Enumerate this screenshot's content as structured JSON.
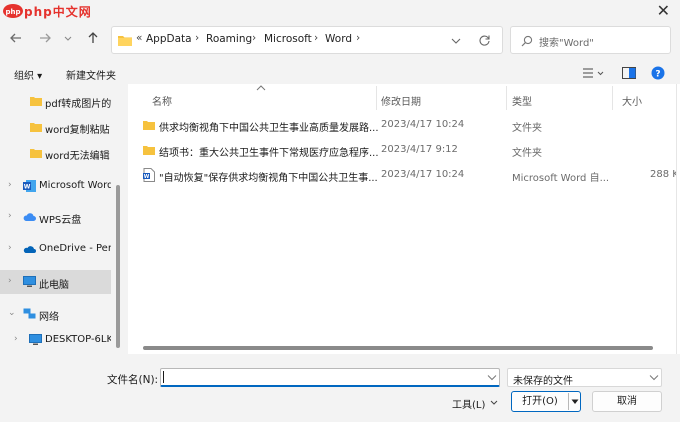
{
  "watermark": {
    "text": "php中文网"
  },
  "window": {
    "close_glyph": "✕"
  },
  "nav": {
    "back_icon": "arrow-left-icon",
    "forward_icon": "arrow-right-icon",
    "recent_icon": "chevron-down-icon",
    "up_icon": "arrow-up-icon",
    "overflow": "«",
    "breadcrumbs": [
      "AppData",
      "Roaming",
      "Microsoft",
      "Word"
    ],
    "search_placeholder": "搜索\"Word\""
  },
  "toolbar": {
    "organize": "组织 ▾",
    "new_folder": "新建文件夹"
  },
  "sidebar": {
    "items": [
      {
        "label": "pdf转成图片的",
        "icon": "folder-icon"
      },
      {
        "label": "word复制粘贴",
        "icon": "folder-icon"
      },
      {
        "label": "word无法编辑",
        "icon": "folder-icon"
      },
      {
        "label": "Microsoft Word",
        "icon": "word-icon"
      },
      {
        "label": "WPS云盘",
        "icon": "cloud-icon"
      },
      {
        "label": "OneDrive - Pers",
        "icon": "onedrive-icon"
      },
      {
        "label": "此电脑",
        "icon": "computer-icon"
      },
      {
        "label": "网络",
        "icon": "network-icon"
      },
      {
        "label": "DESKTOP-6LK",
        "icon": "monitor-icon"
      }
    ]
  },
  "table": {
    "columns": [
      "名称",
      "修改日期",
      "类型",
      "大小"
    ],
    "rows": [
      {
        "name": "供求均衡视角下中国公共卫生事业高质量发展路...",
        "date": "2023/4/17 10:24",
        "type": "文件夹",
        "size": ""
      },
      {
        "name": "结项书：重大公共卫生事件下常规医疗应急程序...",
        "date": "2023/4/17 9:12",
        "type": "文件夹",
        "size": ""
      },
      {
        "name": "\"自动恢复\"保存供求均衡视角下中国公共卫生事...",
        "date": "2023/4/17 10:24",
        "type": "Microsoft Word 自...",
        "size": "288 K"
      }
    ]
  },
  "bottom": {
    "filename_label": "文件名(N):",
    "filename_value": "",
    "filetype_value": "未保存的文件",
    "tools_label": "工具(L)",
    "open_label": "打开(O)",
    "cancel_label": "取消"
  },
  "colors": {
    "accent": "#0067c0",
    "folder": "#f6c23e",
    "word_blue": "#185abd",
    "help_blue": "#1a73e8"
  }
}
